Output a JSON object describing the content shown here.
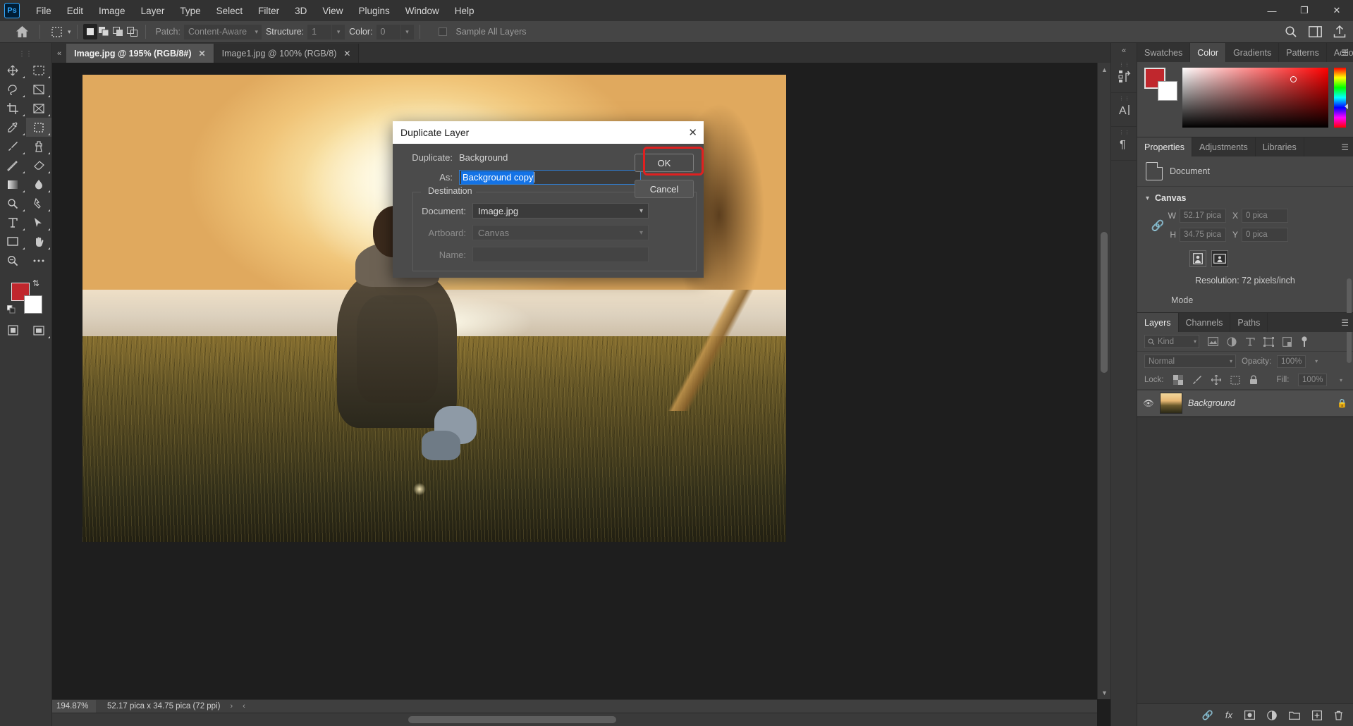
{
  "app": {
    "name": "Adobe Photoshop",
    "logo_text": "Ps"
  },
  "menubar": {
    "items": [
      {
        "label": "File"
      },
      {
        "label": "Edit"
      },
      {
        "label": "Image"
      },
      {
        "label": "Layer"
      },
      {
        "label": "Type"
      },
      {
        "label": "Select"
      },
      {
        "label": "Filter"
      },
      {
        "label": "3D"
      },
      {
        "label": "View"
      },
      {
        "label": "Plugins"
      },
      {
        "label": "Window"
      },
      {
        "label": "Help"
      }
    ],
    "window_controls": {
      "minimize": "—",
      "maximize": "❐",
      "close": "✕"
    }
  },
  "options_bar": {
    "patch_label": "Patch:",
    "patch_value": "Content-Aware",
    "structure_label": "Structure:",
    "structure_value": "1",
    "color_label": "Color:",
    "color_value": "0",
    "sample_all_layers_label": "Sample All Layers"
  },
  "document_tabs": [
    {
      "label": "Image.jpg @ 195% (RGB/8#)",
      "active": true,
      "close": "✕"
    },
    {
      "label": "Image1.jpg @ 100% (RGB/8)",
      "active": false,
      "close": "✕"
    }
  ],
  "status_bar": {
    "zoom": "194.87%",
    "dimensions": "52.17 pica x 34.75 pica (72 ppi)",
    "arrow_right": "›",
    "arrow_left": "‹"
  },
  "dialog": {
    "title": "Duplicate Layer",
    "close": "✕",
    "duplicate_label": "Duplicate:",
    "duplicate_value": "Background",
    "as_label": "As:",
    "as_value": "Background copy",
    "destination_legend": "Destination",
    "document_label": "Document:",
    "document_value": "Image.jpg",
    "artboard_label": "Artboard:",
    "artboard_value": "Canvas",
    "name_label": "Name:",
    "name_value": "",
    "ok_label": "OK",
    "cancel_label": "Cancel",
    "highlight_color": "#e02020"
  },
  "right_dock": {
    "collapse": "«",
    "top_tabs": [
      {
        "label": "Swatches",
        "active": false
      },
      {
        "label": "Color",
        "active": true
      },
      {
        "label": "Gradients",
        "active": false
      },
      {
        "label": "Patterns",
        "active": false
      },
      {
        "label": "Actions",
        "active": false
      }
    ],
    "color_panel": {
      "foreground": "#c0272d",
      "background": "#ffffff"
    },
    "properties_tabs": [
      {
        "label": "Properties",
        "active": true
      },
      {
        "label": "Adjustments",
        "active": false
      },
      {
        "label": "Libraries",
        "active": false
      }
    ],
    "properties": {
      "doc_label": "Document",
      "canvas_label": "Canvas",
      "w_label": "W",
      "w_value": "52.17 pica",
      "h_label": "H",
      "h_value": "34.75 pica",
      "x_label": "X",
      "x_value": "0 pica",
      "y_label": "Y",
      "y_value": "0 pica",
      "resolution": "Resolution: 72 pixels/inch",
      "mode_label": "Mode"
    },
    "layers_tabs": [
      {
        "label": "Layers",
        "active": true
      },
      {
        "label": "Channels",
        "active": false
      },
      {
        "label": "Paths",
        "active": false
      }
    ],
    "layers": {
      "filter_kind": "Kind",
      "blend_mode": "Normal",
      "opacity_label": "Opacity:",
      "opacity_value": "100%",
      "lock_label": "Lock:",
      "fill_label": "Fill:",
      "fill_value": "100%",
      "rows": [
        {
          "name": "Background",
          "locked": true,
          "visible": true
        }
      ]
    }
  },
  "icon_rail": {
    "collapse": "«",
    "items": [
      {
        "name": "history-icon"
      },
      {
        "name": "character-icon"
      },
      {
        "name": "paragraph-icon"
      }
    ]
  },
  "toolbar": {
    "tools": [
      "move-tool",
      "rectangular-marquee-tool",
      "lasso-tool",
      "object-selection-tool",
      "crop-tool",
      "frame-tool",
      "eyedropper-tool",
      "patch-tool",
      "brush-tool",
      "clone-stamp-tool",
      "history-brush-tool",
      "eraser-tool",
      "gradient-tool",
      "blur-tool",
      "dodge-tool",
      "pen-tool",
      "type-tool",
      "path-selection-tool",
      "rectangle-tool",
      "hand-tool",
      "zoom-tool",
      "more-tools",
      "edit-toolbar-tool",
      "screen-mode-tool"
    ],
    "foreground_color": "#c0272d",
    "background_color": "#ffffff"
  }
}
